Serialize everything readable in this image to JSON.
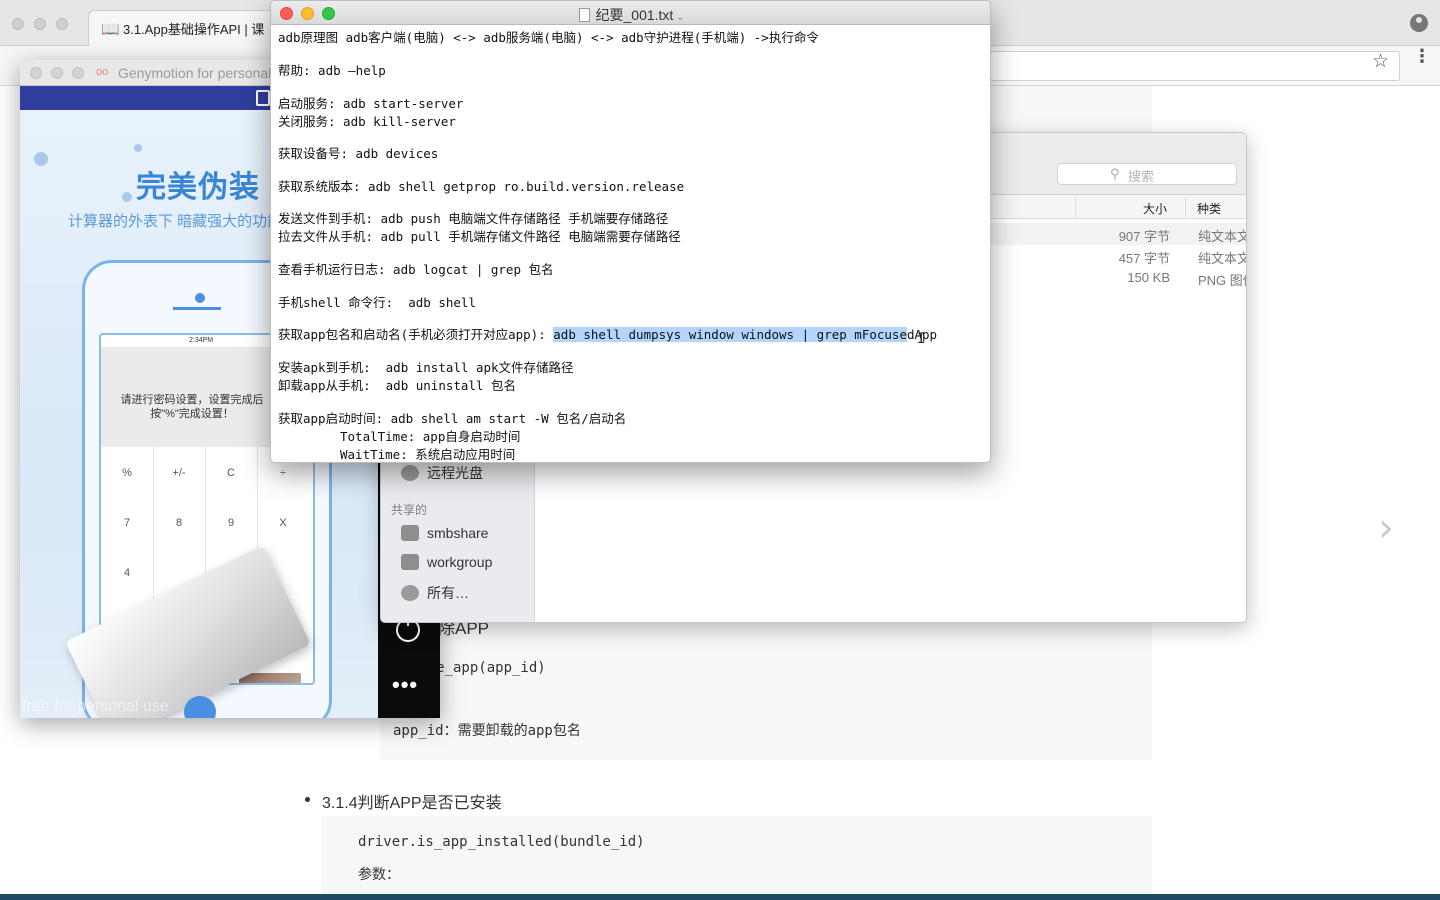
{
  "browser": {
    "tab_title": "3.1.App基础操作API | 课",
    "tab_icon": "book-icon"
  },
  "doc": {
    "item_heading_partial": "除APP",
    "code_remove_app": "remove_app(app_id)",
    "param_app_id": "app_id：需要卸载的app包名",
    "section_heading": "3.1.4判断APP是否已安装",
    "code_is_installed": "driver.is_app_installed(bundle_id)",
    "param_label": "参数："
  },
  "genymotion": {
    "window_title": "Genymotion for personal use",
    "app_title": "完美伪装",
    "app_subtitle": "计算器的外表下  暗藏强大的功能",
    "inner_time": "2:34PM",
    "dialog_text": "请进行密码设置，设置完成后按\"%\"完成设置！",
    "calc_keys": [
      "%",
      "+/-",
      "C",
      "÷",
      "7",
      "8",
      "9",
      "X",
      "4"
    ],
    "watermark": "free for personal use"
  },
  "finder": {
    "search_placeholder": "搜索",
    "columns": {
      "size": "大小",
      "kind": "种类"
    },
    "rows": [
      {
        "size": "907 字节",
        "kind": "纯文本文稿"
      },
      {
        "size": "457 字节",
        "kind": "纯文本文稿"
      },
      {
        "size": "150 KB",
        "kind": "PNG 图像"
      }
    ],
    "sidebar": {
      "remote_disc": "远程光盘",
      "shared_heading": "共享的",
      "shared_items": [
        "smbshare",
        "workgroup",
        "所有…"
      ]
    }
  },
  "textedit": {
    "title": "纪要_001.txt",
    "lines": [
      "adb原理图 adb客户端(电脑) <-> adb服务端(电脑) <-> adb守护进程(手机端) ->执行命令",
      "帮助: adb —help",
      "启动服务: adb start-server",
      "关闭服务: adb kill-server",
      "获取设备号: adb devices",
      "获取系统版本: adb shell getprop ro.build.version.release",
      "发送文件到手机: adb push 电脑端文件存储路径 手机端要存储路径",
      "拉去文件从手机: adb pull 手机端存储文件路径 电脑端需要存储路径",
      "查看手机运行日志: adb logcat | grep 包名",
      "手机shell 命令行:  adb shell",
      "获取app包名和启动名(手机必须打开对应app): ",
      "安装apk到手机:  adb install apk文件存储路径",
      "卸载app从手机:  adb uninstall 包名",
      "获取app启动时间: adb shell am start -W 包名/启动名",
      "TotalTime: app自身启动时间",
      "WaitTime: 系统启动应用时间"
    ],
    "selected_text": "adb shell dumpsys window windows | grep mFocuse",
    "after_selection": "dApp"
  }
}
